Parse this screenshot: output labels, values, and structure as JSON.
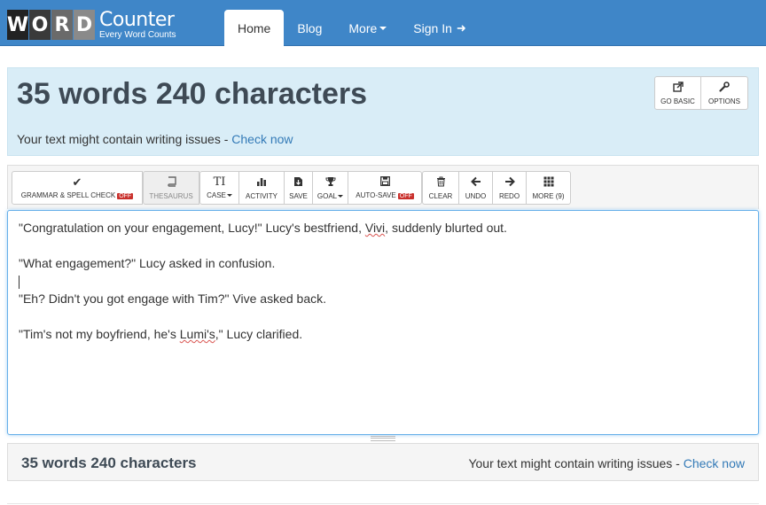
{
  "navbar": {
    "logo_letters": [
      "W",
      "O",
      "R",
      "D"
    ],
    "logo_word": "Counter",
    "logo_tagline": "Every Word Counts",
    "items": [
      {
        "label": "Home"
      },
      {
        "label": "Blog"
      },
      {
        "label": "More"
      },
      {
        "label": "Sign In"
      }
    ],
    "active": "Home",
    "color": "#3f86c8"
  },
  "header": {
    "title": "35 words 240 characters",
    "issues_text": "Your text might contain writing issues - ",
    "issues_link": "Check now",
    "buttons": [
      {
        "label": "GO BASIC",
        "icon": "external-link-icon"
      },
      {
        "label": "OPTIONS",
        "icon": "wrench-icon"
      }
    ]
  },
  "toolbar": {
    "grammar_label": "GRAMMAR & SPELL CHECK",
    "grammar_state": "OFF",
    "thesaurus_label": "THESAURUS",
    "case_label": "CASE",
    "activity_label": "ACTIVITY",
    "save_label": "SAVE",
    "goal_label": "GOAL",
    "autosave_label": "AUTO-SAVE",
    "autosave_state": "OFF",
    "clear_label": "CLEAR",
    "undo_label": "UNDO",
    "redo_label": "REDO",
    "more_label": "MORE (9)"
  },
  "editor": {
    "line1_a": "\"Congratulation on your engagement, Lucy!\" Lucy's bestfriend, ",
    "line1_word": "Vivi",
    "line1_b": ", suddenly blurted out.",
    "line2": "\"What engagement?\" Lucy asked in confusion.",
    "line3": "\"Eh? Didn't you got engage with Tim?\" Vive asked back.",
    "line4_a": "\"Tim's not my boyfriend, he's ",
    "line4_word": "Lumi's",
    "line4_b": ",\" Lucy clarified."
  },
  "footer": {
    "count": "35 words 240 characters",
    "issues_text": "Your text might contain writing issues - ",
    "issues_link": "Check now"
  }
}
